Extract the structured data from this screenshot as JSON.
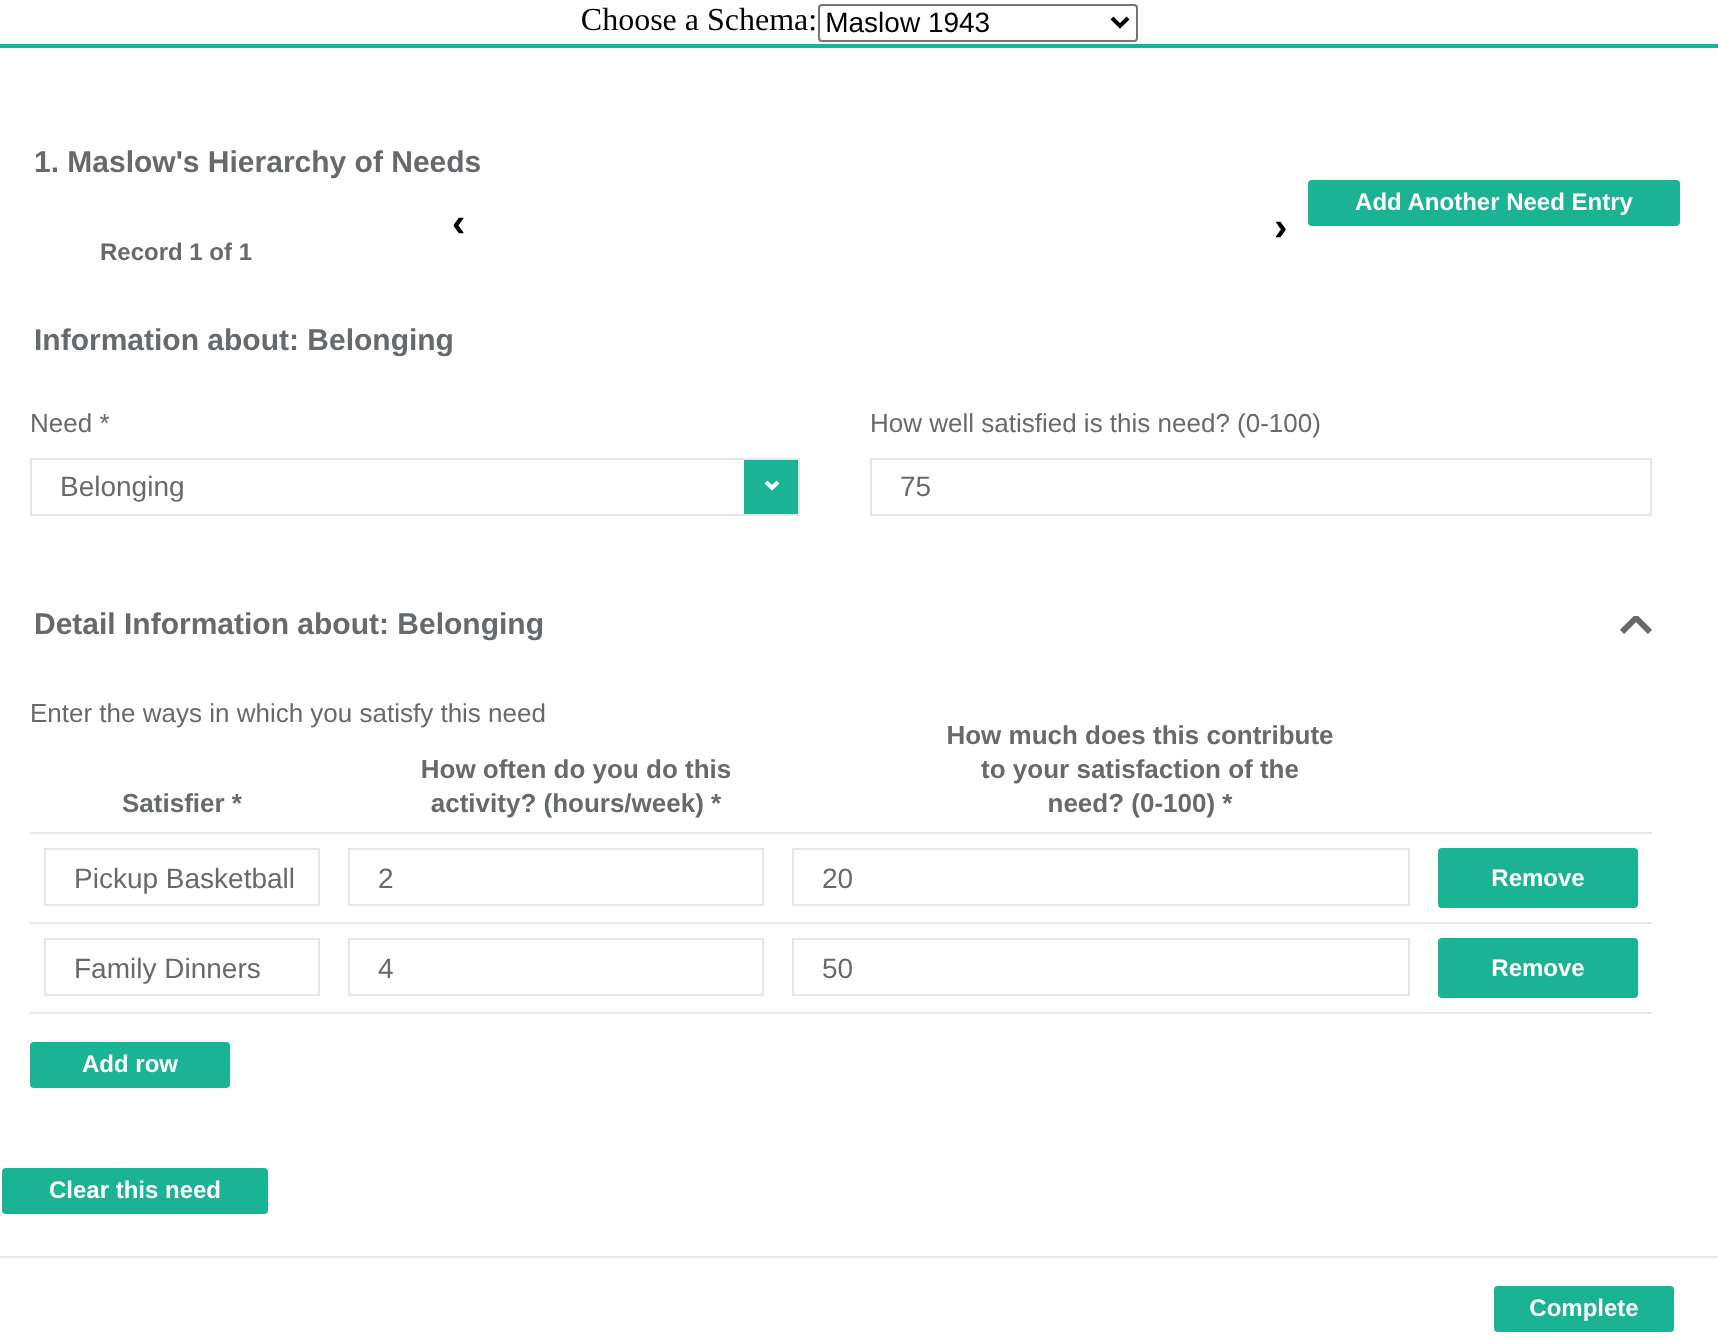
{
  "schema_picker": {
    "label": "Choose a Schema:",
    "value": "Maslow 1943"
  },
  "section": {
    "title": "1. Maslow's Hierarchy of Needs",
    "add_button": "Add Another Need Entry",
    "record": "Record 1 of 1",
    "prev": "‹",
    "next": "›"
  },
  "information": {
    "heading": "Information about: Belonging",
    "need_label": "Need *",
    "need_value": "Belonging",
    "satisfied_label": "How well satisfied is this need? (0-100)",
    "satisfied_value": "75"
  },
  "detail": {
    "heading": "Detail Information about: Belonging",
    "expanded": true,
    "instructions": "Enter the ways in which you satisfy this need",
    "columns": [
      "Satisfier *",
      "How often do you do this activity? (hours/week) *",
      "How much does this contribute to your satisfaction of the need? (0-100) *"
    ],
    "rows": [
      {
        "satisfier": "Pickup Basketball",
        "hours": "2",
        "contribution": "20",
        "remove": "Remove"
      },
      {
        "satisfier": "Family Dinners",
        "hours": "4",
        "contribution": "50",
        "remove": "Remove"
      }
    ],
    "add_row": "Add row"
  },
  "clear_button": "Clear this need",
  "complete_button": "Complete"
}
